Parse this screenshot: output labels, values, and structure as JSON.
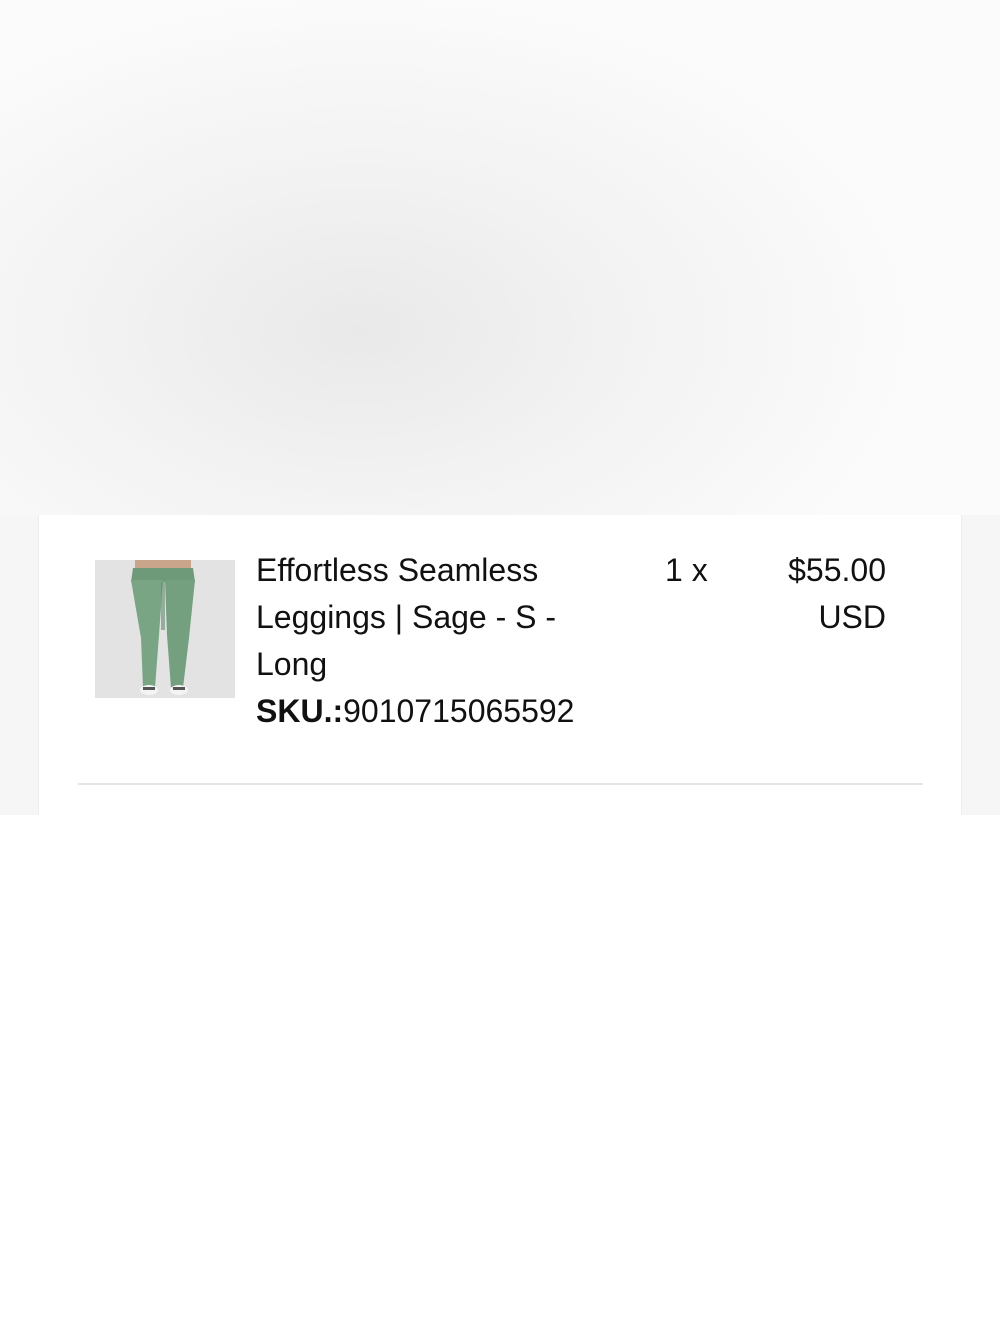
{
  "order_item": {
    "product_name": "Effortless Seamless Leggings | Sage - S - Long",
    "sku_label": "SKU.:",
    "sku_value": "9010715065592",
    "quantity": "1 x",
    "price": "$55.00",
    "currency": "USD",
    "thumbnail_icon": "leggings-product-photo",
    "thumbnail_color": "#79a484"
  }
}
